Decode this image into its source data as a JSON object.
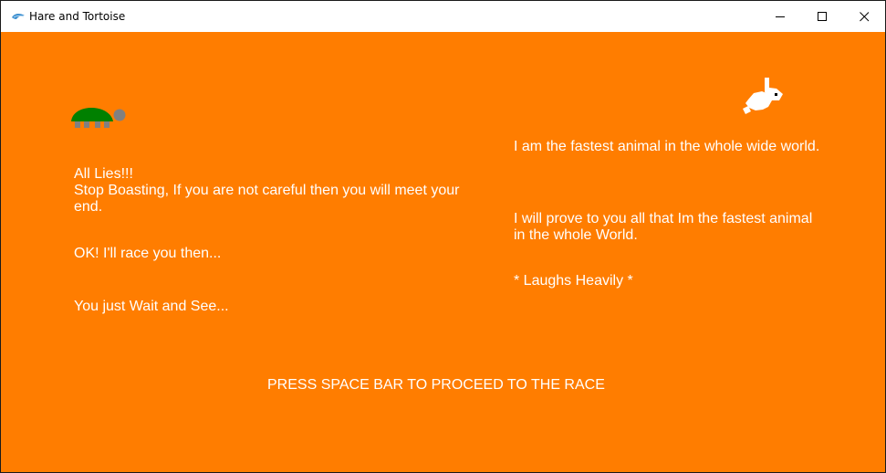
{
  "window": {
    "title": "Hare and Tortoise",
    "icon": "snake-logo-icon"
  },
  "controls": {
    "minimize_icon": "minimize-icon",
    "maximize_icon": "maximize-icon",
    "close_icon": "close-icon"
  },
  "colors": {
    "background": "#ff7d00",
    "text": "#ffffff",
    "tortoise_shell": "#008000",
    "tortoise_body": "#808080",
    "hare_body": "#ffffff"
  },
  "tortoise": {
    "sprite": "tortoise-sprite",
    "lines": [
      "All Lies!!!",
      "Stop Boasting, If you are not careful then you will meet your",
      "end.",
      "OK! I'll race you then...",
      "You just Wait and See..."
    ]
  },
  "hare": {
    "sprite": "hare-sprite",
    "lines": [
      "I am the fastest animal in the whole wide world.",
      "I will prove to you all that Im the fastest animal",
      "in the whole World.",
      "* Laughs Heavily *"
    ]
  },
  "prompt": "PRESS SPACE BAR TO PROCEED TO THE RACE"
}
